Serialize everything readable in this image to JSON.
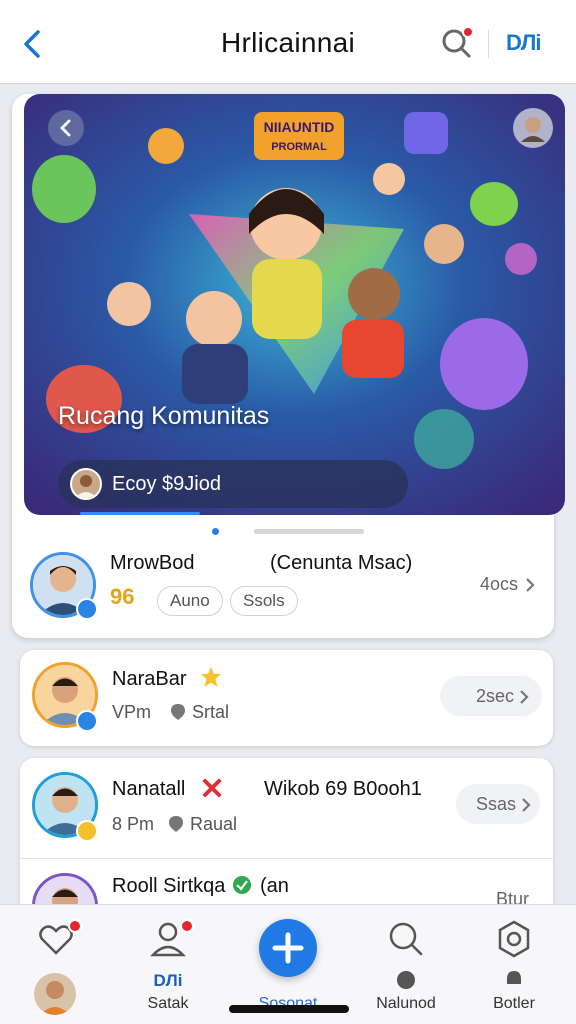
{
  "header": {
    "title": "Hrlicainnai",
    "brand": "DЛi",
    "icons": {
      "back": "chevron-left-icon",
      "search": "search-icon"
    },
    "accent_color": "#1976d2"
  },
  "hero": {
    "badge_text": "NIIAUNTID\nPRORMAL",
    "title": "Rucang Komunitas",
    "pill_text": "Ecoy $9Jiod"
  },
  "feed": [
    {
      "name": "MrowBod",
      "name_extra": "(Cenunta Msac)",
      "chips": [
        "Auno",
        "Ssols"
      ],
      "prefix_badge": "96",
      "time": "4ocs"
    },
    {
      "name": "NaraBar",
      "time_line": "VPm",
      "location": "Srtal",
      "time": "2sec"
    },
    {
      "name": "Nanatall",
      "name_extra": "Wikob 69 B0ooh1",
      "time_line": "8 Pm",
      "location": "Raual",
      "time": "Ssas"
    },
    {
      "name": "Rooll Sirtkqa",
      "name_extra": "(an",
      "time": "Btur"
    }
  ],
  "tabbar": {
    "tabs": [
      {
        "label": "",
        "icon": "heart-chat-icon"
      },
      {
        "label": "Satak",
        "sub": "DЛi",
        "icon": "user-icon"
      },
      {
        "label": "Sosonat",
        "icon": "plus-icon"
      },
      {
        "label": "Nalunod",
        "icon": "search-icon"
      },
      {
        "label": "Botler",
        "icon": "settings-icon"
      }
    ]
  }
}
